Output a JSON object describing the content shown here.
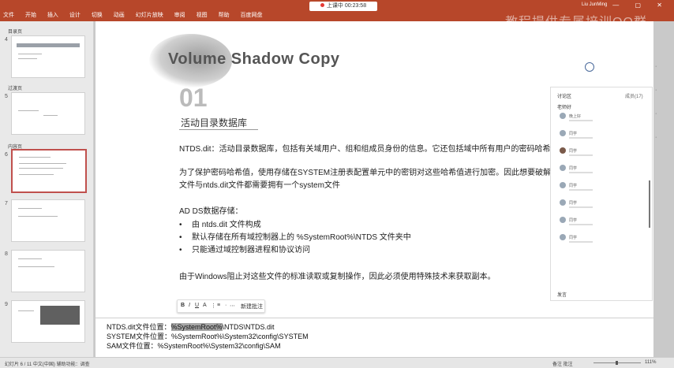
{
  "ribbon": {
    "tabs": [
      "文件",
      "开始",
      "插入",
      "设计",
      "切换",
      "动画",
      "幻灯片放映",
      "审阅",
      "视图",
      "帮助",
      "百度网盘"
    ],
    "rec_label": "上课中 00:23:58",
    "user": "Liu JunMing",
    "watermark": "教程提供专属培训QQ群",
    "window_controls": "— ▢ ✕"
  },
  "sidebar": {
    "sections": [
      "目录页",
      "过渡页",
      "内容页"
    ],
    "slide_numbers": [
      "4",
      "5",
      "6",
      "7",
      "8",
      "9"
    ]
  },
  "slide": {
    "title": "Volume Shadow Copy",
    "section_number": "01",
    "section_title": "活动目录数据库",
    "paragraph1": "NTDS.dit：活动目录数据库，包括有关域用户、组和组成员身份的信息。它还包括域中所有用户的密码哈希值。",
    "paragraph2_line1": "为了保护密码哈希值，使用存储在SYSTEM注册表配置单元中的密钥对这些哈希值进行加密。因此想要破解SAM",
    "paragraph2_line2": "文件与ntds.dit文件都需要拥有一个system文件",
    "storage_heading": "AD DS数据存储：",
    "bullets": [
      "由 ntds.dit 文件构成",
      "默认存储在所有域控制器上的 %SystemRoot%\\NTDS 文件夹中",
      "只能通过域控制器进程和协议访问"
    ],
    "closing": "由于Windows阻止对这些文件的标准读取或复制操作，因此必须使用特殊技术来获取副本。",
    "toolbar": [
      "B",
      "I",
      "U",
      "A",
      "⋮",
      "≡",
      "·",
      "⋯",
      "新建批注"
    ]
  },
  "chat": {
    "header": "讨论区",
    "badge": "成员(17)",
    "greeting": "老师好",
    "names": [
      "晚上好",
      "同学",
      "同学",
      "同学",
      "同学",
      "同学",
      "同学",
      "同学"
    ],
    "input_hint": "发言"
  },
  "notes": {
    "line1_prefix": "NTDS.dit文件位置：",
    "line1_highlight": "%SystemRoot%",
    "line1_suffix": "\\NTDS\\NTDS.dit",
    "line2": "SYSTEM文件位置：%SystemRoot%\\System32\\config\\SYSTEM",
    "line3": "SAM文件位置：%SystemRoot%\\System32\\config\\SAM"
  },
  "status": {
    "left": "幻灯片 6 / 11    中文(中国)    辅助功能：调查",
    "right": "备注  批注",
    "zoom": "111%"
  }
}
